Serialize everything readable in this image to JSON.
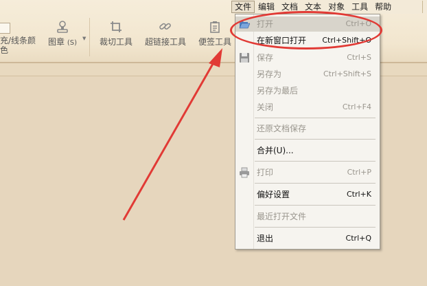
{
  "menubar": {
    "items": [
      {
        "label": "文件",
        "active": true
      },
      {
        "label": "编辑"
      },
      {
        "label": "文档"
      },
      {
        "label": "文本"
      },
      {
        "label": "对象"
      },
      {
        "label": "工具"
      },
      {
        "label": "帮助"
      }
    ]
  },
  "toolbar": {
    "fill_line_color": "充/线条颜\n色",
    "fill_line_color_l1": "充/线条颜",
    "fill_line_color_l2": "色",
    "stamp": "图章",
    "stamp_hotkey": "(S)",
    "crop": "裁切工具",
    "hyperlink": "超链接工具",
    "note": "便签工具"
  },
  "file_menu": {
    "items": [
      {
        "label": "打开",
        "shortcut": "Ctrl+O",
        "enabled": false,
        "highlighted": true,
        "icon": "folder-open-icon"
      },
      {
        "label": "在新窗口打开",
        "shortcut": "Ctrl+Shift+O",
        "enabled": true
      },
      {
        "label": "保存",
        "shortcut": "Ctrl+S",
        "enabled": false,
        "icon": "save-disk-icon"
      },
      {
        "label": "另存为",
        "shortcut": "Ctrl+Shift+S",
        "enabled": false
      },
      {
        "label": "另存为最后",
        "shortcut": "",
        "enabled": false
      },
      {
        "label": "关闭",
        "shortcut": "Ctrl+F4",
        "enabled": false
      },
      {
        "label": "还原文档保存",
        "shortcut": "",
        "enabled": false
      },
      {
        "label": "合并(U)...",
        "shortcut": "",
        "enabled": true
      },
      {
        "label": "打印",
        "shortcut": "Ctrl+P",
        "enabled": false,
        "icon": "printer-icon"
      },
      {
        "label": "偏好设置",
        "shortcut": "Ctrl+K",
        "enabled": true
      },
      {
        "label": "最近打开文件",
        "shortcut": "",
        "enabled": false
      },
      {
        "label": "退出",
        "shortcut": "Ctrl+Q",
        "enabled": true
      }
    ]
  },
  "colors": {
    "annotation_red": "#e13a35",
    "toolbar_bg": "#f2e6cf",
    "workspace_bg": "#e6d6bd",
    "menu_bg": "#f6f4ef"
  }
}
